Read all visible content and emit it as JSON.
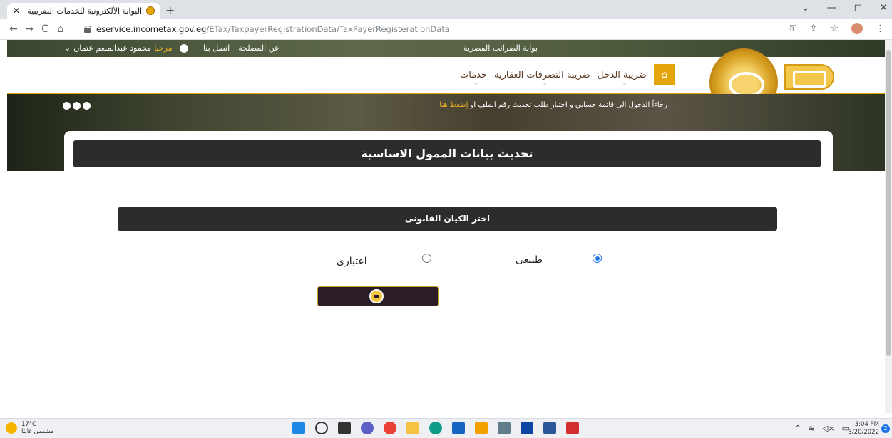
{
  "browser": {
    "tab_title": "البوابة الألكترونية للخدمات الضريبية",
    "tab_close": "✕",
    "new_tab": "+",
    "url_host": "eservice.incometax.gov.eg",
    "url_path": "/ETax/TaxpayerRegistrationData/TaxPayerRegisterationData",
    "win_controls": [
      "⌄",
      "—",
      "◻",
      "✕"
    ]
  },
  "site": {
    "welcome_prefix": "مرحبا",
    "user_name": "محمود عبدالمنعم عثمان",
    "user_caret": "⌄",
    "links": [
      "اتصل بنا",
      "عن المصلحة"
    ],
    "portal_name": "بوابة الضرائب المصرية",
    "nav": [
      "ضريبة الدخل",
      "ضريبة التصرفات العقارية",
      "خدمات"
    ],
    "notice_text": "رجاءاً الدخول الى قائمة حسابي و اختيار طلب تحديث رقم الملف او",
    "notice_link": "إضغط هنا"
  },
  "page": {
    "title": "تحديث بيانات الممول الاساسية",
    "section_title": "اختر الكيان القانونى",
    "radio_natural": "طبيعى",
    "radio_legal": "اعتبارى",
    "selected": "طبيعى"
  },
  "taskbar": {
    "temp": "17°C",
    "weather": "مشمس غالبًا",
    "time": "3:04 PM",
    "date": "3/20/2022",
    "notifications": "2"
  },
  "colors": {
    "accent": "#e5a60d",
    "dark_bar": "#2c2c2c",
    "button": "#2a1d28",
    "radio": "#1a73e8"
  }
}
